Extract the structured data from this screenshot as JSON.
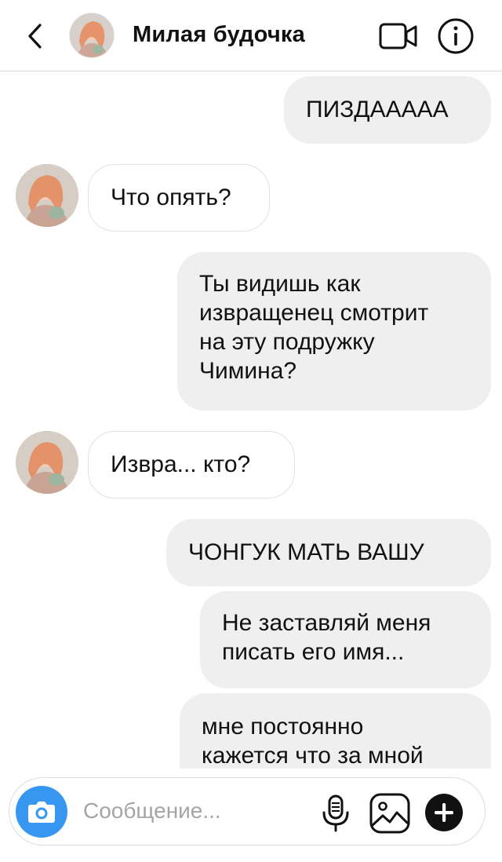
{
  "header": {
    "title": "Милая будочка",
    "icons": {
      "back": "chevron-left-icon",
      "video": "video-call-icon",
      "info": "info-icon"
    }
  },
  "messages": [
    {
      "direction": "sent",
      "text": "ПИЗДААААА"
    },
    {
      "direction": "received",
      "text": "Что опять?"
    },
    {
      "direction": "sent",
      "text": "Ты видишь как извращенец смотрит на эту подружку Чимина?",
      "lines": [
        "Ты видишь как",
        "извращенец смотрит",
        "на эту подружку",
        "Чимина?"
      ]
    },
    {
      "direction": "received",
      "text": "Извра... кто?"
    },
    {
      "direction": "sent",
      "text": "ЧОНГУК МАТЬ ВАШУ"
    },
    {
      "direction": "sent",
      "text": "Не заставляй меня писать его имя...",
      "lines": [
        "Не заставляй меня",
        "писать его имя..."
      ]
    },
    {
      "direction": "sent",
      "text": "мне постоянно кажется что за мной",
      "lines": [
        "мне постоянно",
        "кажется что за мной"
      ]
    }
  ],
  "composer": {
    "placeholder": "Сообщение...",
    "icons": {
      "camera": "camera-icon",
      "mic": "microphone-icon",
      "gallery": "gallery-icon",
      "plus": "plus-icon"
    }
  },
  "colors": {
    "sent_bubble": "#efefef",
    "received_border": "#e0e0e0",
    "camera_button": "#3797f0"
  }
}
